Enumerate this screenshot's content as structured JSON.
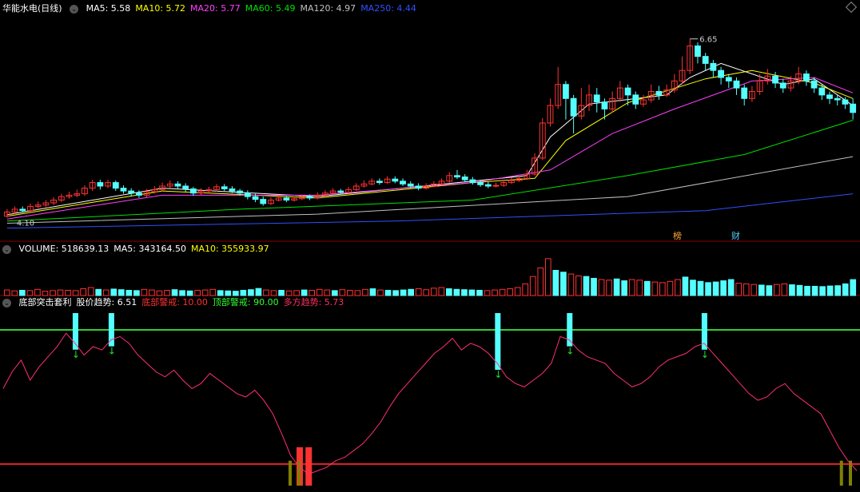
{
  "colors": {
    "up": "#ff3232",
    "down": "#54ffff",
    "ma5": "#ffffff",
    "ma10": "#ffff00",
    "ma20": "#ff00ff",
    "ma60": "#00e000",
    "ma120": "#c0c0c0",
    "ma250": "#3050ff"
  },
  "price_header": {
    "title": "华能水电(日线)",
    "items": [
      {
        "label": "MA5: 5.58",
        "color": "#ffffff"
      },
      {
        "label": "MA10: 5.72",
        "color": "#ffff00"
      },
      {
        "label": "MA20: 5.77",
        "color": "#ff40ff"
      },
      {
        "label": "MA60: 5.49",
        "color": "#00e000"
      },
      {
        "label": "MA120: 4.97",
        "color": "#c0c0c0"
      },
      {
        "label": "MA250: 4.44",
        "color": "#3050ff"
      }
    ]
  },
  "volume_header": {
    "items": [
      {
        "label": "VOLUME: 518639.13",
        "color": "#ffffff"
      },
      {
        "label": "MA5: 343164.50",
        "color": "#ffffff"
      },
      {
        "label": "MA10: 355933.97",
        "color": "#ffff00"
      }
    ]
  },
  "indicator_header": {
    "items": [
      {
        "label": "底部突击套利",
        "color": "#ffffff"
      },
      {
        "label": "股价趋势: 6.51",
        "color": "#ffffff"
      },
      {
        "label": "底部警戒: 10.00",
        "color": "#ff3030"
      },
      {
        "label": "顶部警戒: 90.00",
        "color": "#30ff30"
      },
      {
        "label": "多方趋势: 5.73",
        "color": "#ff3060"
      }
    ]
  },
  "annotations": {
    "high": "6.65",
    "low": "4.10",
    "badge_bang": "榜",
    "badge_cai": "财"
  },
  "chart_data": [
    {
      "type": "candlestick",
      "title": "华能水电(日线)",
      "high_label": 6.65,
      "low_label": 4.1,
      "ylim": [
        3.9,
        7.0
      ],
      "candles": [
        [
          4.12,
          4.18,
          4.22,
          4.1
        ],
        [
          4.18,
          4.22,
          4.26,
          4.15
        ],
        [
          4.22,
          4.2,
          4.26,
          4.17
        ],
        [
          4.2,
          4.26,
          4.3,
          4.18
        ],
        [
          4.26,
          4.28,
          4.33,
          4.23
        ],
        [
          4.28,
          4.31,
          4.35,
          4.25
        ],
        [
          4.31,
          4.35,
          4.39,
          4.28
        ],
        [
          4.35,
          4.4,
          4.44,
          4.32
        ],
        [
          4.4,
          4.42,
          4.47,
          4.37
        ],
        [
          4.42,
          4.44,
          4.5,
          4.39
        ],
        [
          4.44,
          4.52,
          4.56,
          4.41
        ],
        [
          4.52,
          4.6,
          4.64,
          4.48
        ],
        [
          4.6,
          4.55,
          4.64,
          4.5
        ],
        [
          4.55,
          4.6,
          4.64,
          4.52
        ],
        [
          4.6,
          4.52,
          4.63,
          4.48
        ],
        [
          4.52,
          4.48,
          4.56,
          4.44
        ],
        [
          4.48,
          4.45,
          4.52,
          4.4
        ],
        [
          4.45,
          4.42,
          4.49,
          4.38
        ],
        [
          4.42,
          4.47,
          4.51,
          4.39
        ],
        [
          4.47,
          4.5,
          4.55,
          4.44
        ],
        [
          4.5,
          4.55,
          4.6,
          4.47
        ],
        [
          4.55,
          4.58,
          4.63,
          4.52
        ],
        [
          4.58,
          4.55,
          4.62,
          4.51
        ],
        [
          4.55,
          4.51,
          4.59,
          4.47
        ],
        [
          4.51,
          4.45,
          4.54,
          4.41
        ],
        [
          4.45,
          4.48,
          4.52,
          4.42
        ],
        [
          4.48,
          4.5,
          4.54,
          4.45
        ],
        [
          4.5,
          4.54,
          4.58,
          4.47
        ],
        [
          4.54,
          4.51,
          4.58,
          4.48
        ],
        [
          4.51,
          4.48,
          4.55,
          4.45
        ],
        [
          4.48,
          4.45,
          4.51,
          4.41
        ],
        [
          4.45,
          4.4,
          4.49,
          4.36
        ],
        [
          4.4,
          4.36,
          4.44,
          4.32
        ],
        [
          4.36,
          4.3,
          4.4,
          4.27
        ],
        [
          4.3,
          4.35,
          4.39,
          4.28
        ],
        [
          4.35,
          4.38,
          4.42,
          4.33
        ],
        [
          4.38,
          4.35,
          4.41,
          4.32
        ],
        [
          4.35,
          4.37,
          4.4,
          4.33
        ],
        [
          4.37,
          4.4,
          4.43,
          4.35
        ],
        [
          4.4,
          4.38,
          4.43,
          4.35
        ],
        [
          4.38,
          4.42,
          4.46,
          4.36
        ],
        [
          4.42,
          4.45,
          4.49,
          4.4
        ],
        [
          4.45,
          4.48,
          4.52,
          4.43
        ],
        [
          4.48,
          4.46,
          4.51,
          4.43
        ],
        [
          4.46,
          4.5,
          4.54,
          4.44
        ],
        [
          4.5,
          4.55,
          4.59,
          4.48
        ],
        [
          4.55,
          4.58,
          4.63,
          4.53
        ],
        [
          4.58,
          4.62,
          4.66,
          4.56
        ],
        [
          4.62,
          4.6,
          4.66,
          4.57
        ],
        [
          4.6,
          4.65,
          4.69,
          4.58
        ],
        [
          4.65,
          4.62,
          4.69,
          4.59
        ],
        [
          4.62,
          4.58,
          4.66,
          4.55
        ],
        [
          4.58,
          4.55,
          4.62,
          4.52
        ],
        [
          4.55,
          4.52,
          4.59,
          4.49
        ],
        [
          4.52,
          4.55,
          4.59,
          4.5
        ],
        [
          4.55,
          4.58,
          4.62,
          4.53
        ],
        [
          4.58,
          4.62,
          4.66,
          4.56
        ],
        [
          4.62,
          4.7,
          4.75,
          4.6
        ],
        [
          4.7,
          4.68,
          4.78,
          4.65
        ],
        [
          4.68,
          4.64,
          4.72,
          4.6
        ],
        [
          4.64,
          4.6,
          4.68,
          4.57
        ],
        [
          4.6,
          4.57,
          4.64,
          4.54
        ],
        [
          4.57,
          4.55,
          4.61,
          4.52
        ],
        [
          4.55,
          4.56,
          4.6,
          4.53
        ],
        [
          4.56,
          4.6,
          4.64,
          4.54
        ],
        [
          4.6,
          4.63,
          4.67,
          4.58
        ],
        [
          4.63,
          4.66,
          4.7,
          4.61
        ],
        [
          4.66,
          4.72,
          4.78,
          4.64
        ],
        [
          4.72,
          4.95,
          5.02,
          4.7
        ],
        [
          4.95,
          5.45,
          5.52,
          4.92
        ],
        [
          5.45,
          5.7,
          5.8,
          5.4
        ],
        [
          5.7,
          6.0,
          6.25,
          5.65
        ],
        [
          6.0,
          5.8,
          6.05,
          5.5
        ],
        [
          5.8,
          5.55,
          5.85,
          5.3
        ],
        [
          5.55,
          5.7,
          5.95,
          5.5
        ],
        [
          5.7,
          5.85,
          6.0,
          5.62
        ],
        [
          5.85,
          5.75,
          5.95,
          5.6
        ],
        [
          5.75,
          5.65,
          5.8,
          5.5
        ],
        [
          5.65,
          5.8,
          5.9,
          5.6
        ],
        [
          5.8,
          5.95,
          6.05,
          5.75
        ],
        [
          5.95,
          5.85,
          6.0,
          5.7
        ],
        [
          5.85,
          5.72,
          5.9,
          5.65
        ],
        [
          5.72,
          5.78,
          5.85,
          5.68
        ],
        [
          5.78,
          5.9,
          6.0,
          5.74
        ],
        [
          5.9,
          5.85,
          5.98,
          5.78
        ],
        [
          5.85,
          5.92,
          6.0,
          5.82
        ],
        [
          5.92,
          6.05,
          6.15,
          5.88
        ],
        [
          6.05,
          6.2,
          6.4,
          6.0
        ],
        [
          6.2,
          6.55,
          6.65,
          6.15
        ],
        [
          6.55,
          6.4,
          6.6,
          6.3
        ],
        [
          6.4,
          6.3,
          6.45,
          6.2
        ],
        [
          6.3,
          6.2,
          6.35,
          6.1
        ],
        [
          6.2,
          6.1,
          6.25,
          6.0
        ],
        [
          6.1,
          6.05,
          6.15,
          5.95
        ],
        [
          6.05,
          5.95,
          6.1,
          5.85
        ],
        [
          5.95,
          5.8,
          6.0,
          5.7
        ],
        [
          5.8,
          5.9,
          5.98,
          5.75
        ],
        [
          5.9,
          6.05,
          6.15,
          5.85
        ],
        [
          6.05,
          6.12,
          6.22,
          6.0
        ],
        [
          6.12,
          6.02,
          6.18,
          5.95
        ],
        [
          6.02,
          5.95,
          6.08,
          5.88
        ],
        [
          5.95,
          6.05,
          6.12,
          5.9
        ],
        [
          6.05,
          6.15,
          6.25,
          6.0
        ],
        [
          6.15,
          6.05,
          6.2,
          5.98
        ],
        [
          6.05,
          5.95,
          6.1,
          5.88
        ],
        [
          5.95,
          5.85,
          6.0,
          5.78
        ],
        [
          5.85,
          5.8,
          5.9,
          5.72
        ],
        [
          5.8,
          5.78,
          5.85,
          5.7
        ],
        [
          5.78,
          5.72,
          5.82,
          5.65
        ],
        [
          5.72,
          5.6,
          5.8,
          5.5
        ]
      ],
      "ma": [
        {
          "name": "MA5",
          "color": "#ffffff",
          "values": [
            [
              0,
              4.14
            ],
            [
              20,
              4.52
            ],
            [
              40,
              4.4
            ],
            [
              60,
              4.62
            ],
            [
              67,
              4.7
            ],
            [
              70,
              5.25
            ],
            [
              75,
              5.72
            ],
            [
              85,
              5.85
            ],
            [
              88,
              6.1
            ],
            [
              92,
              6.3
            ],
            [
              100,
              6.0
            ],
            [
              104,
              6.08
            ],
            [
              110,
              5.7
            ]
          ]
        },
        {
          "name": "MA10",
          "color": "#ffff00",
          "values": [
            [
              0,
              4.12
            ],
            [
              20,
              4.48
            ],
            [
              40,
              4.38
            ],
            [
              60,
              4.6
            ],
            [
              68,
              4.66
            ],
            [
              72,
              5.2
            ],
            [
              80,
              5.74
            ],
            [
              90,
              6.08
            ],
            [
              96,
              6.2
            ],
            [
              104,
              6.02
            ],
            [
              110,
              5.8
            ]
          ]
        },
        {
          "name": "MA20",
          "color": "#ff40ff",
          "values": [
            [
              0,
              4.08
            ],
            [
              20,
              4.42
            ],
            [
              40,
              4.42
            ],
            [
              60,
              4.6
            ],
            [
              70,
              4.78
            ],
            [
              78,
              5.3
            ],
            [
              86,
              5.65
            ],
            [
              96,
              6.05
            ],
            [
              104,
              6.1
            ],
            [
              110,
              5.88
            ]
          ]
        },
        {
          "name": "MA60",
          "color": "#00e000",
          "values": [
            [
              0,
              4.05
            ],
            [
              30,
              4.22
            ],
            [
              60,
              4.35
            ],
            [
              80,
              4.7
            ],
            [
              95,
              5.0
            ],
            [
              110,
              5.49
            ]
          ]
        },
        {
          "name": "MA120",
          "color": "#c0c0c0",
          "values": [
            [
              0,
              4.02
            ],
            [
              40,
              4.15
            ],
            [
              80,
              4.4
            ],
            [
              110,
              4.97
            ]
          ]
        },
        {
          "name": "MA250",
          "color": "#3050ff",
          "values": [
            [
              0,
              3.95
            ],
            [
              50,
              4.05
            ],
            [
              90,
              4.2
            ],
            [
              110,
              4.44
            ]
          ]
        }
      ]
    },
    {
      "type": "bar",
      "title": "VOLUME",
      "series": [
        {
          "name": "VOLUME",
          "values": [
            180,
            150,
            170,
            160,
            200,
            140,
            160,
            180,
            170,
            160,
            220,
            260,
            200,
            180,
            210,
            190,
            170,
            160,
            200,
            180,
            150,
            170,
            190,
            160,
            150,
            170,
            180,
            200,
            160,
            150,
            140,
            170,
            190,
            230,
            180,
            160,
            170,
            150,
            160,
            180,
            170,
            200,
            180,
            160,
            190,
            170,
            160,
            200,
            220,
            180,
            170,
            160,
            180,
            200,
            220,
            190,
            240,
            260,
            220,
            200,
            190,
            180,
            170,
            160,
            180,
            200,
            220,
            260,
            380,
            620,
            900,
            1200,
            820,
            760,
            700,
            640,
            620,
            560,
            520,
            500,
            540,
            480,
            520,
            500,
            460,
            440,
            420,
            460,
            520,
            600,
            500,
            460,
            420,
            440,
            480,
            520,
            400,
            380,
            360,
            340,
            320,
            360,
            380,
            350,
            330,
            300,
            300,
            290,
            310,
            320,
            380,
            518
          ]
        }
      ],
      "ma": [
        {
          "name": "MA5",
          "value": 343164.5
        },
        {
          "name": "MA10",
          "value": 355933.97
        }
      ],
      "ylim": [
        0,
        1300
      ]
    },
    {
      "type": "line",
      "title": "底部突击套利",
      "ylim": [
        0,
        100
      ],
      "thresholds": [
        {
          "name": "底部警戒",
          "value": 10.0
        },
        {
          "name": "顶部警戒",
          "value": 90.0
        }
      ],
      "series": [
        {
          "name": "股价趋势",
          "values": [
            55,
            65,
            72,
            60,
            68,
            74,
            80,
            88,
            82,
            75,
            80,
            78,
            84,
            86,
            82,
            75,
            70,
            65,
            62,
            66,
            60,
            55,
            58,
            64,
            60,
            56,
            52,
            50,
            54,
            48,
            40,
            28,
            15,
            8,
            4,
            6,
            8,
            12,
            14,
            18,
            22,
            28,
            35,
            44,
            52,
            58,
            64,
            70,
            76,
            80,
            85,
            78,
            82,
            80,
            76,
            70,
            62,
            58,
            56,
            60,
            64,
            70,
            86,
            84,
            78,
            74,
            72,
            70,
            64,
            60,
            56,
            58,
            62,
            68,
            72,
            74,
            76,
            80,
            82,
            76,
            70,
            64,
            58,
            52,
            48,
            50,
            55,
            58,
            52,
            48,
            44,
            40,
            30,
            20,
            12,
            6
          ]
        }
      ],
      "signals": {
        "up_bars": [
          33,
          34
        ],
        "down_markers": [
          8,
          12,
          55,
          63,
          78
        ]
      }
    }
  ]
}
